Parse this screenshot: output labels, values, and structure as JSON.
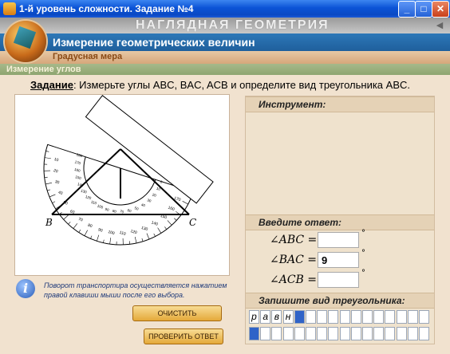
{
  "window": {
    "title": "1-й уровень сложности. Задание №4",
    "controls": {
      "minimize": "_",
      "maximize": "□",
      "close": "✕"
    }
  },
  "app": {
    "name": "НАГЛЯДНАЯ ГЕОМЕТРИЯ",
    "section": "Измерение геометрических величин",
    "subsection": "Градусная мера",
    "topic": "Измерение углов"
  },
  "task": {
    "label": "Задание",
    "text": ": Измерьте углы ABC, BAC, ACB и определите вид треугольника ABC."
  },
  "figure": {
    "vertex_b": "B",
    "vertex_c": "C",
    "protractor_outer_ticks": [
      "10",
      "20",
      "30",
      "40",
      "50",
      "60",
      "70",
      "80",
      "90",
      "100",
      "110",
      "120",
      "130",
      "140",
      "150",
      "160",
      "170"
    ],
    "protractor_inner_ticks": [
      "0",
      "10",
      "20",
      "30",
      "40",
      "50",
      "60",
      "70",
      "80",
      "90",
      "100",
      "110",
      "120",
      "130",
      "140",
      "150",
      "160",
      "170",
      "180"
    ]
  },
  "panel": {
    "tool_header": "Инструмент:",
    "answer_header": "Введите ответ:",
    "answers": [
      {
        "label": "∠ABC =",
        "value": "",
        "unit": "°"
      },
      {
        "label": "∠BAC =",
        "value": "9",
        "unit": "°"
      },
      {
        "label": "∠ACB =",
        "value": "",
        "unit": "°"
      }
    ],
    "type_header": "Запишите вид треугольника:",
    "letters_row1": [
      "р",
      "а",
      "в",
      "н",
      "",
      "",
      "",
      "",
      "",
      "",
      "",
      "",
      "",
      "",
      "",
      ""
    ],
    "letters_row2": [
      "",
      "",
      "",
      "",
      "",
      "",
      "",
      "",
      "",
      "",
      "",
      "",
      "",
      "",
      "",
      ""
    ]
  },
  "info": {
    "icon": "i",
    "text": "Поворот транспортира осуществляется нажатием правой клавиши мыши после его выбора."
  },
  "buttons": {
    "clear": "ОЧИСТИТЬ",
    "check": "ПРОВЕРИТЬ ОТВЕТ"
  },
  "colors": {
    "title_bar": "#0b53d6",
    "section_band": "#1f5f9c",
    "subsection_text": "#8a4a16",
    "topic_band": "#8ea570",
    "cursor_cell": "#2f63c8"
  }
}
